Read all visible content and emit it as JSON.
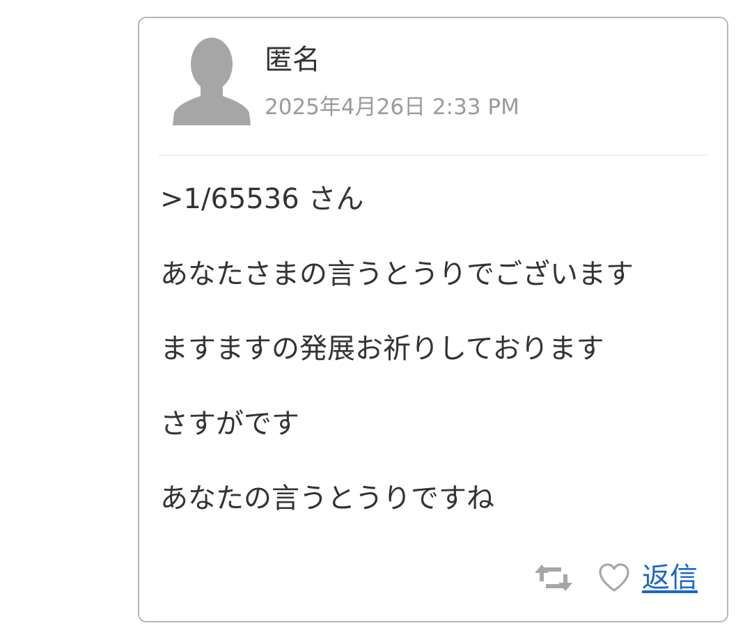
{
  "comment": {
    "author": "匿名",
    "timestamp": "2025年4月26日 2:33 PM",
    "body_lines": [
      ">1/65536 さん",
      "あなたさまの言うとうりでございます",
      "ますますの発展お祈りしております",
      "さすがです",
      "あなたの言うとうりですね"
    ]
  },
  "actions": {
    "retweet_icon": "retweet-icon",
    "like_icon": "heart-outline-icon",
    "reply_label": "返信"
  },
  "colors": {
    "text": "#333333",
    "muted": "#9a9a9a",
    "icon": "#a6a6a6",
    "link": "#1a66c8",
    "border": "#b5b5b5"
  }
}
